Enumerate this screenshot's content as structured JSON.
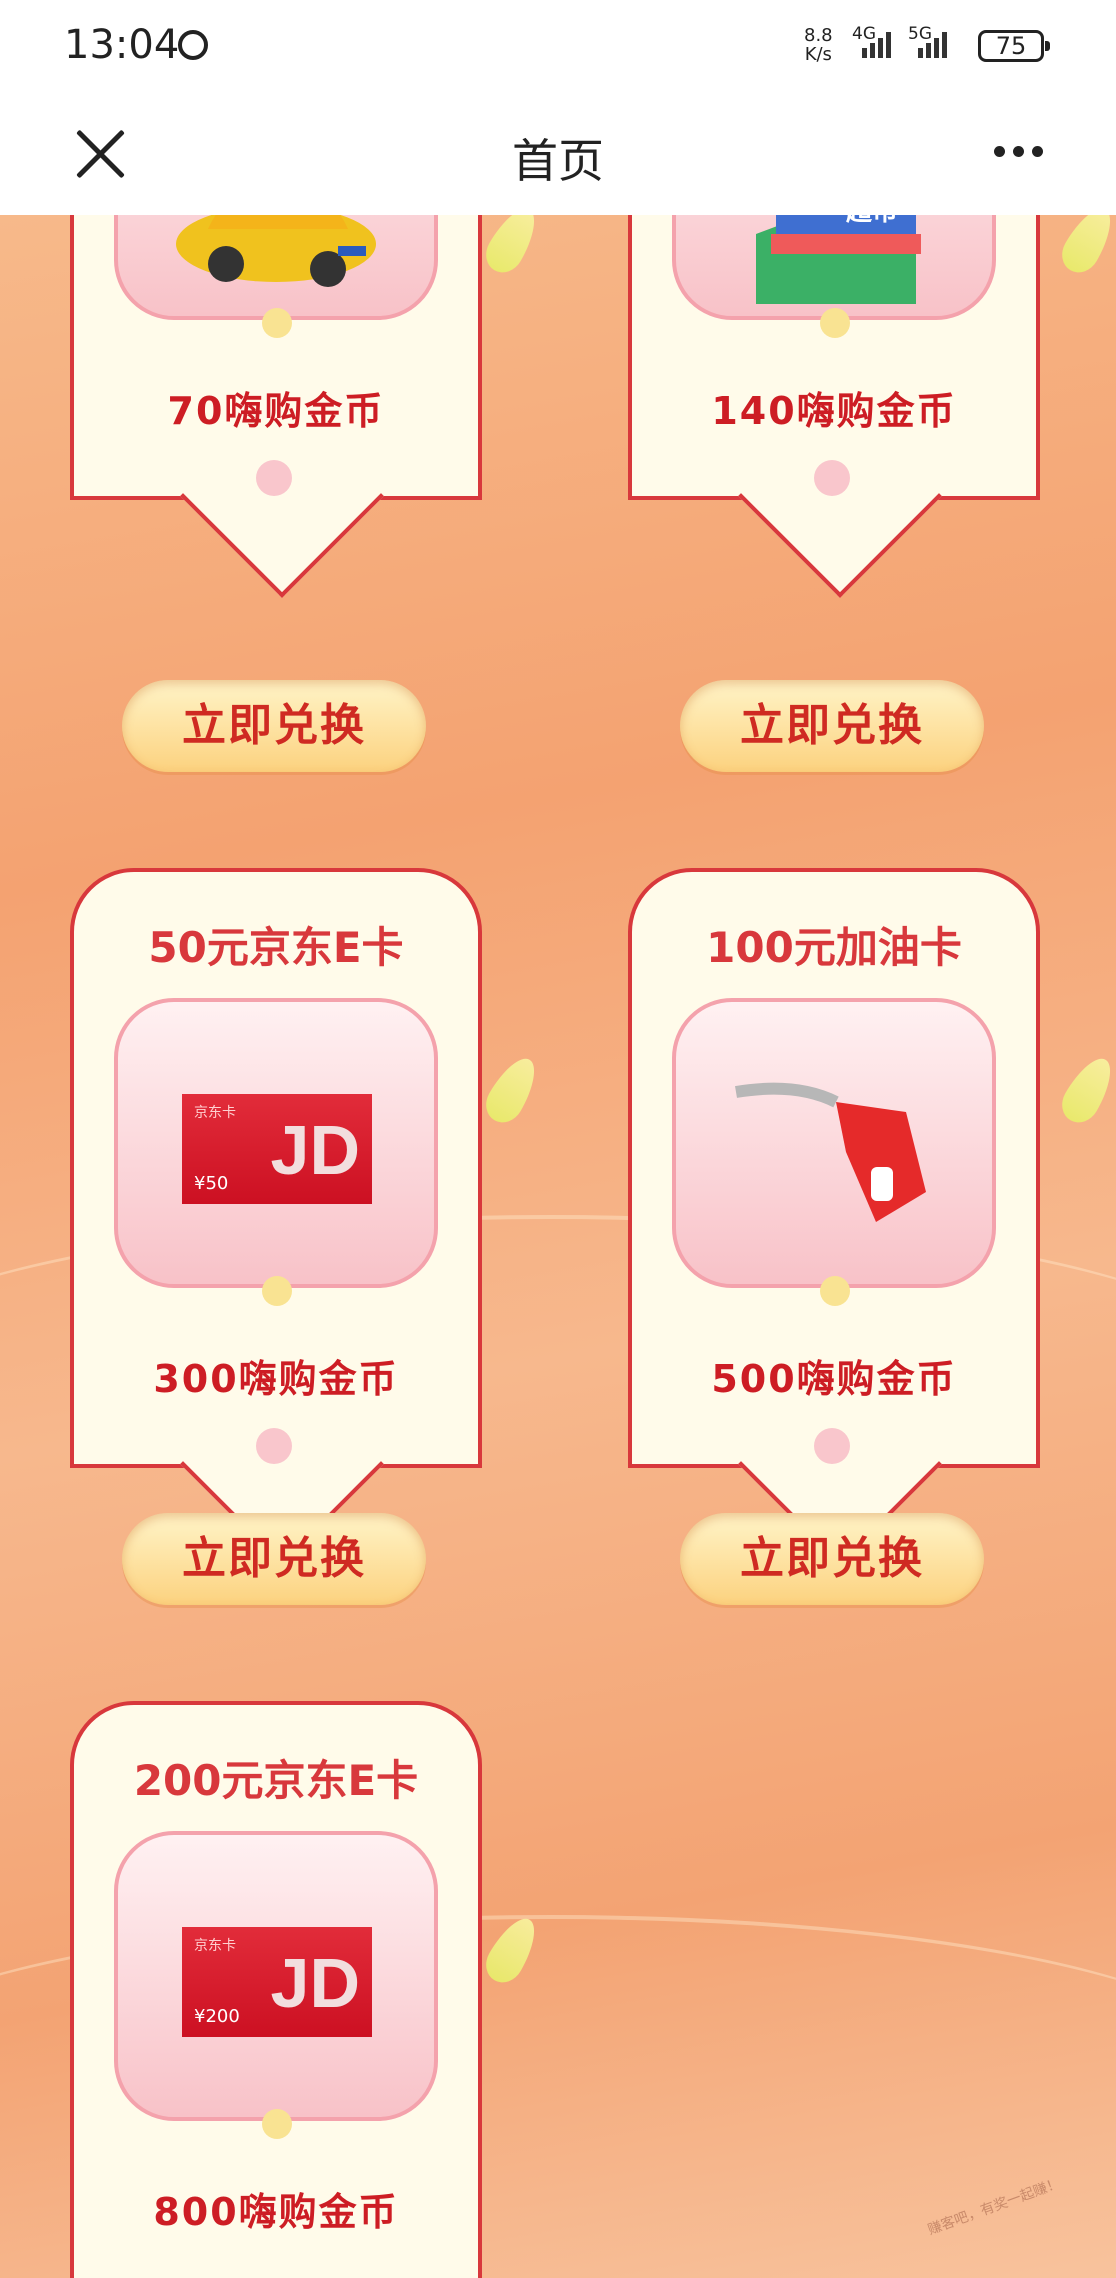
{
  "status_bar": {
    "time": "13:04",
    "net_speed_value": "8.8",
    "net_speed_unit": "K/s",
    "sim1": "4G",
    "sim2": "5G",
    "battery": "75"
  },
  "nav": {
    "title": "首页"
  },
  "cards": [
    {
      "title": "",
      "price": "70嗨购金币",
      "button": "立即兑换",
      "image": "car"
    },
    {
      "title": "",
      "price": "140嗨购金币",
      "button": "立即兑换",
      "image": "supermarket",
      "image_text": "超市"
    },
    {
      "title": "50元京东E卡",
      "price": "300嗨购金币",
      "button": "立即兑换",
      "image": "jd-card",
      "card_small": "京东卡",
      "card_value": "¥50",
      "card_logo": "JD"
    },
    {
      "title": "100元加油卡",
      "price": "500嗨购金币",
      "button": "立即兑换",
      "image": "fuel-nozzle"
    },
    {
      "title": "200元京东E卡",
      "price": "800嗨购金币",
      "button": "",
      "image": "jd-card",
      "card_small": "京东卡",
      "card_value": "¥200",
      "card_logo": "JD"
    }
  ],
  "watermark": "赚客吧，有奖一起赚！"
}
